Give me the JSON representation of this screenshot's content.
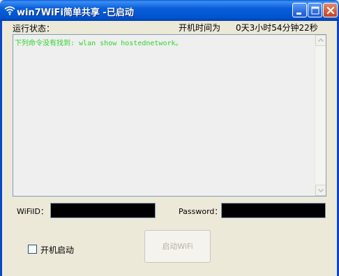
{
  "window": {
    "title": "win7WiFi简单共享 -已启动"
  },
  "status": {
    "label": "运行状态：",
    "uptime_label": "开机时间为",
    "uptime_value": "0天3小时54分钟22秒"
  },
  "log": {
    "lines": [
      "下列命令没有找到: wlan show hostednetwork。"
    ]
  },
  "form": {
    "wifi_id_label": "WiFiID：",
    "wifi_id_value": "",
    "password_label": "Password：",
    "password_value": ""
  },
  "options": {
    "autostart_label": "开机启动",
    "autostart_checked": false
  },
  "actions": {
    "start_wifi_label": "启动WiFi"
  },
  "colors": {
    "log_text": "#2fd52f",
    "titlebar": "#0a5fd8"
  }
}
